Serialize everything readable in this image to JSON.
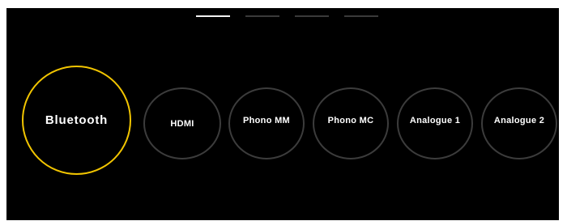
{
  "colors": {
    "background": "#000000",
    "selected_ring": "#f2c500",
    "ring": "#3c3c3c",
    "label": "#ffffff",
    "pager_active": "#f2f2f2",
    "pager_inactive": "#3a3a3a"
  },
  "pager": {
    "total_pages": 4,
    "current_page": 1
  },
  "sources": [
    {
      "label": "Bluetooth",
      "selected": true
    },
    {
      "label": "HDMI",
      "selected": false
    },
    {
      "label": "Phono MM",
      "selected": false
    },
    {
      "label": "Phono MC",
      "selected": false
    },
    {
      "label": "Analogue 1",
      "selected": false
    },
    {
      "label": "Analogue 2",
      "selected": false
    }
  ]
}
